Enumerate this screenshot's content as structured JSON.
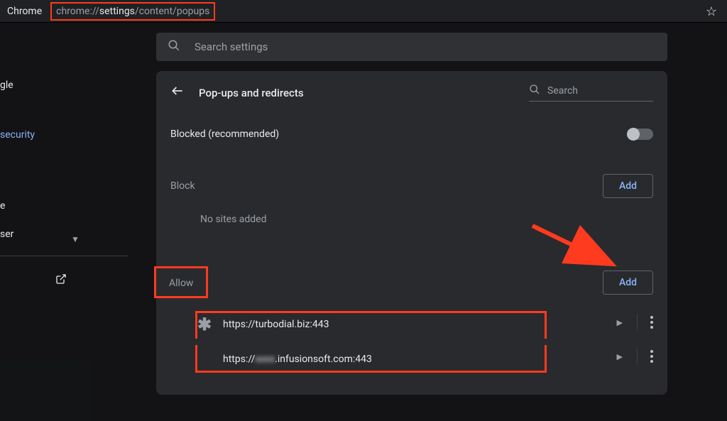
{
  "browser": {
    "label": "Chrome",
    "url_prefix": "chrome://",
    "url_highlight": "settings",
    "url_suffix": "/content/popups"
  },
  "search_settings": {
    "placeholder": "Search settings"
  },
  "sidebar": {
    "items": [
      {
        "label": "gle",
        "active": false
      },
      {
        "label": "security",
        "active": true
      },
      {
        "label": "e",
        "active": false
      },
      {
        "label": "ser",
        "active": false
      }
    ]
  },
  "panel": {
    "title": "Pop-ups and redirects",
    "search_placeholder": "Search",
    "blocked_label": "Blocked (recommended)",
    "block_section_label": "Block",
    "no_sites_text": "No sites added",
    "allow_section_label": "Allow",
    "add_button_label": "Add",
    "allow_sites": [
      {
        "url_prefix": "https://",
        "url_blur": "",
        "url_main": "turbodial.biz:443",
        "icon_type": "asterisk"
      },
      {
        "url_prefix": "https://",
        "url_blur": "xxxx",
        "url_main": ".infusionsoft.com:443",
        "icon_type": "green"
      }
    ]
  }
}
